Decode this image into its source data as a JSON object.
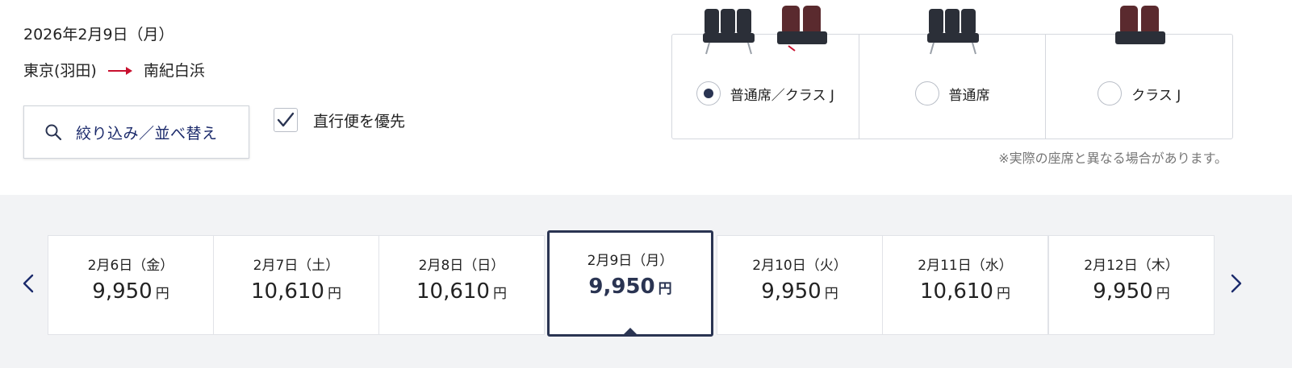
{
  "header": {
    "date": "2026年2月9日（月）",
    "origin": "東京(羽田)",
    "destination": "南紀白浜"
  },
  "filter_button": {
    "label": "絞り込み／並べ替え",
    "icon": "search-icon"
  },
  "direct_flight": {
    "label": "直行便を優先",
    "checked": true
  },
  "seat_options": [
    {
      "label": "普通席／クラス J",
      "selected": true
    },
    {
      "label": "普通席",
      "selected": false
    },
    {
      "label": "クラス J",
      "selected": false
    }
  ],
  "disclaimer": "※実際の座席と異なる場合があります。",
  "fare_calendar": {
    "prev_icon": "chevron-left-icon",
    "next_icon": "chevron-right-icon",
    "currency": "円",
    "days": [
      {
        "date": "2月6日（金）",
        "price": "9,950",
        "selected": false
      },
      {
        "date": "2月7日（土）",
        "price": "10,610",
        "selected": false
      },
      {
        "date": "2月8日（日）",
        "price": "10,610",
        "selected": false
      },
      {
        "date": "2月9日（月）",
        "price": "9,950",
        "selected": true
      },
      {
        "date": "2月10日（火）",
        "price": "9,950",
        "selected": false
      },
      {
        "date": "2月11日（水）",
        "price": "10,610",
        "selected": false
      },
      {
        "date": "2月12日（木）",
        "price": "9,950",
        "selected": false
      }
    ]
  },
  "colors": {
    "navy": "#2a3452",
    "link": "#1b2a6b",
    "route_arrow": "#c8102e",
    "strip_bg": "#f2f3f5"
  }
}
